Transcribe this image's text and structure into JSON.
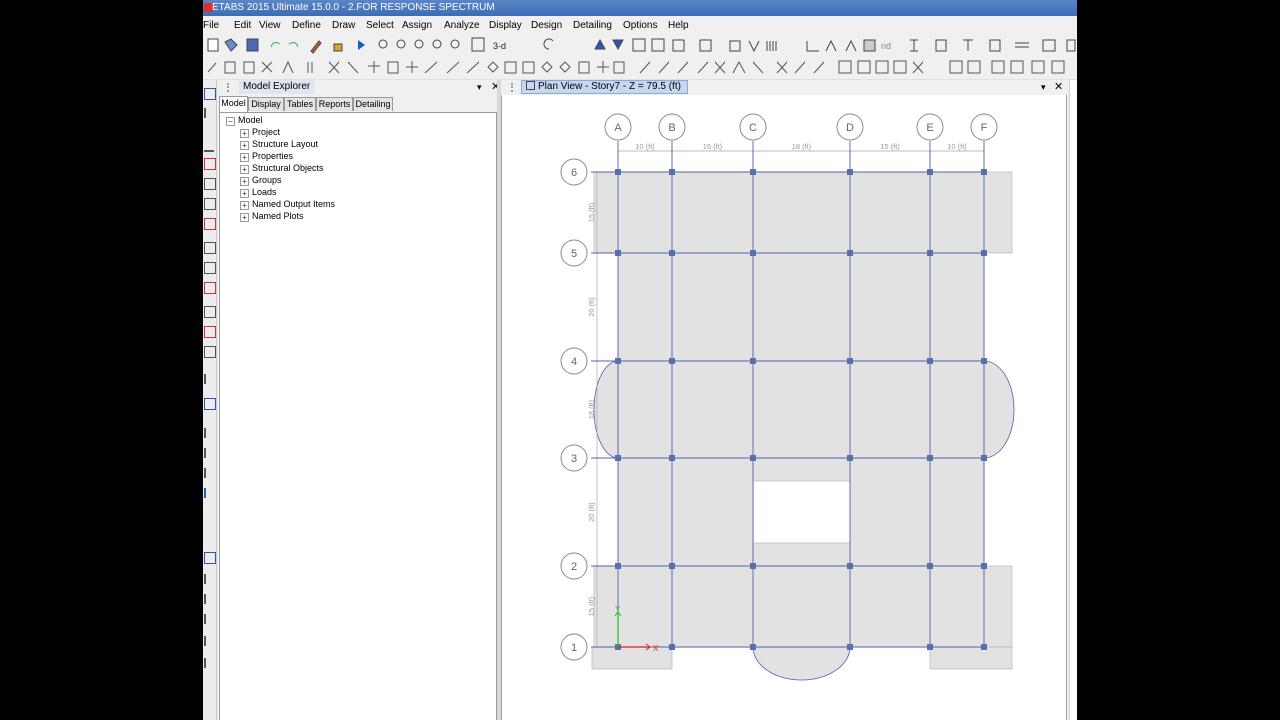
{
  "window": {
    "title": "ETABS 2015 Ultimate 15.0.0 - 2.FOR RESPONSE SPECTRUM"
  },
  "menu": [
    "File",
    "Edit",
    "View",
    "Define",
    "Draw",
    "Select",
    "Assign",
    "Analyze",
    "Display",
    "Design",
    "Detailing",
    "Options",
    "Help"
  ],
  "toolbar": {
    "view_3d_label": "3-d",
    "nd_label": "nd"
  },
  "explorer": {
    "title": "Model Explorer",
    "pin_icon": "pin-icon",
    "close_icon": "close-icon",
    "tabs": [
      {
        "label": "Model",
        "active": true
      },
      {
        "label": "Display",
        "active": false
      },
      {
        "label": "Tables",
        "active": false
      },
      {
        "label": "Reports",
        "active": false
      },
      {
        "label": "Detailing",
        "active": false
      }
    ],
    "tree": {
      "root": "Model",
      "children": [
        "Project",
        "Structure Layout",
        "Properties",
        "Structural Objects",
        "Groups",
        "Loads",
        "Named Output Items",
        "Named Plots"
      ]
    }
  },
  "plan_view": {
    "title": "Plan View - Story7 - Z = 79.5 (ft)",
    "grid_x_labels": [
      "A",
      "B",
      "C",
      "D",
      "E",
      "F"
    ],
    "grid_y_labels": [
      "6",
      "5",
      "4",
      "3",
      "2",
      "1"
    ],
    "x_spacings": [
      "10 (ft)",
      "15 (ft)",
      "18 (ft)",
      "15 (ft)",
      "10 (ft)"
    ],
    "y_spacings": [
      "15 (ft)",
      "20 (ft)",
      "18 (ft)",
      "20 (ft)",
      "15 (ft)"
    ],
    "colors": {
      "slab_fill": "#e2e2e2",
      "grid_line": "#5060a8",
      "column_node": "#5a6fb0",
      "bubble_stroke": "#8a8a8a",
      "axis_x": "#e02020",
      "axis_y": "#20c020"
    }
  }
}
